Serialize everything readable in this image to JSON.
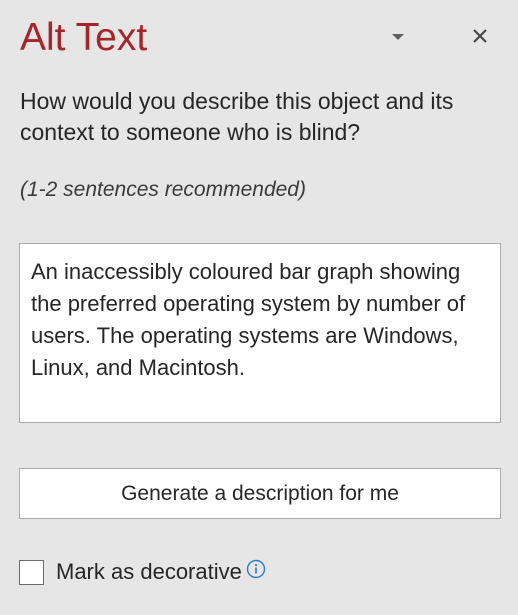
{
  "pane": {
    "title": "Alt Text",
    "question": "How would you describe this object and its context to someone who is blind?",
    "recommendation": "(1-2 sentences recommended)",
    "description_value": "An inaccessibly coloured bar graph showing the preferred operating system by number of users. The operating systems are Windows, Linux, and Macintosh.",
    "generate_button_label": "Generate a description for me",
    "decorative_label": "Mark as decorative",
    "decorative_checked": false
  },
  "icons": {
    "options": "chevron-down-icon",
    "close": "close-icon",
    "info": "info-icon"
  },
  "colors": {
    "title": "#a4262c",
    "background": "#e6e6e6",
    "info_accent": "#2b79d0"
  }
}
